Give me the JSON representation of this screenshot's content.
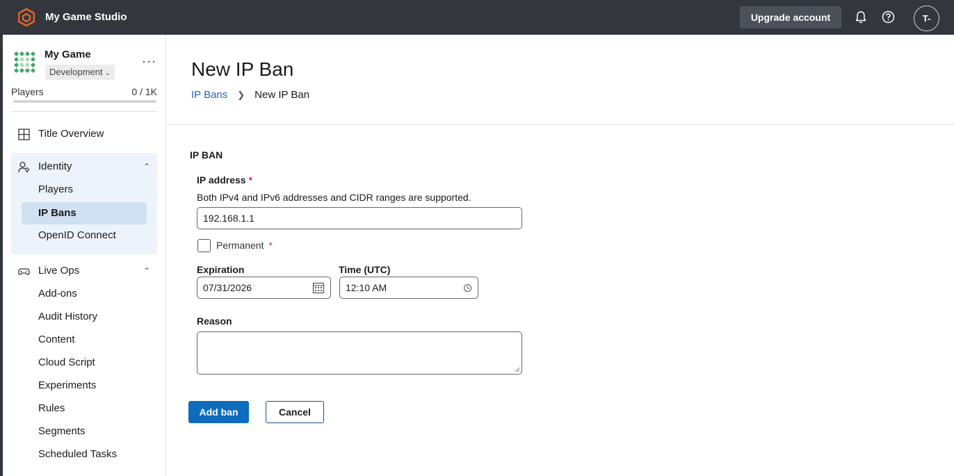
{
  "topbar": {
    "studio_name": "My Game Studio",
    "upgrade_label": "Upgrade account",
    "avatar_initials": "T-"
  },
  "game": {
    "name": "My Game",
    "environment": "Development",
    "players_label": "Players",
    "players_count": "0 / 1K",
    "players_progress": 0.0
  },
  "sidebar": {
    "title_overview": "Title Overview",
    "identity": {
      "label": "Identity",
      "items": [
        "Players",
        "IP Bans",
        "OpenID Connect"
      ]
    },
    "live_ops": {
      "label": "Live Ops",
      "items": [
        "Add-ons",
        "Audit History",
        "Content",
        "Cloud Script",
        "Experiments",
        "Rules",
        "Segments",
        "Scheduled Tasks"
      ]
    }
  },
  "main": {
    "title": "New IP Ban",
    "breadcrumb": {
      "parent": "IP Bans",
      "current": "New IP Ban"
    },
    "section_title": "IP BAN",
    "ip_address": {
      "label": "IP address",
      "required": "*",
      "help": "Both IPv4 and IPv6 addresses and CIDR ranges are supported.",
      "value": "192.168.1.1"
    },
    "permanent": {
      "label": "Permanent",
      "required": "*",
      "checked": false
    },
    "expiration": {
      "label": "Expiration",
      "value": "07/31/2026"
    },
    "time": {
      "label": "Time (UTC)",
      "value": "12:10 AM"
    },
    "reason": {
      "label": "Reason",
      "value": ""
    },
    "buttons": {
      "add": "Add ban",
      "cancel": "Cancel"
    }
  },
  "colors": {
    "topbar": "#33373d",
    "primary": "#0f6cbd",
    "link": "#2166b5",
    "required": "#c4314b",
    "active_nav": "#cfe1f3",
    "group_bg": "#edf3fa",
    "logo": "#e8652b"
  }
}
